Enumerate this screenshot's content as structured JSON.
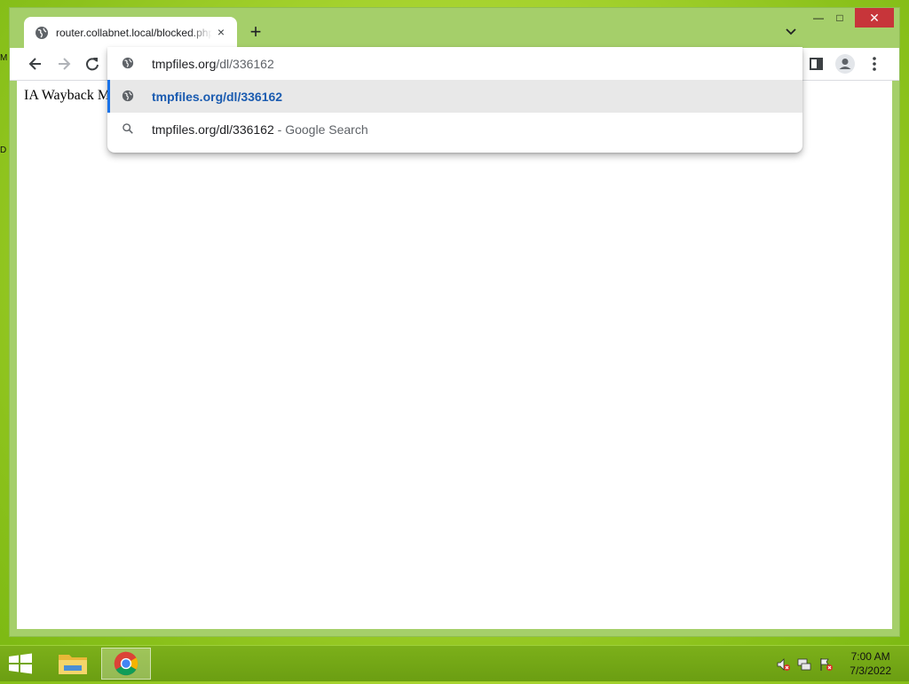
{
  "desktop": {
    "fragment_top": "M",
    "fragment_bottom": "D"
  },
  "window": {
    "tab": {
      "title": "router.collabnet.local/blocked.php",
      "close_icon": "×"
    },
    "new_tab_icon": "+",
    "controls": {
      "minimize": "—",
      "maximize": "□",
      "close": "✕"
    }
  },
  "omnibox": {
    "input_value_host": "tmpfiles.org",
    "input_value_path": "/dl/336162",
    "suggestions": [
      {
        "text": "tmpfiles.org/dl/336162",
        "icon": "globe-icon",
        "selected": true
      },
      {
        "text": "tmpfiles.org/dl/336162",
        "suffix": " - Google Search",
        "icon": "search-icon",
        "selected": false
      }
    ]
  },
  "page": {
    "body_text": "IA Wayback M"
  },
  "taskbar": {
    "time": "7:00 AM",
    "date": "7/3/2022"
  },
  "colors": {
    "accent": "#1a73e8",
    "selected_text": "#1a5bb0",
    "close_red": "#c7353a",
    "frame": "#a5cf6a"
  }
}
